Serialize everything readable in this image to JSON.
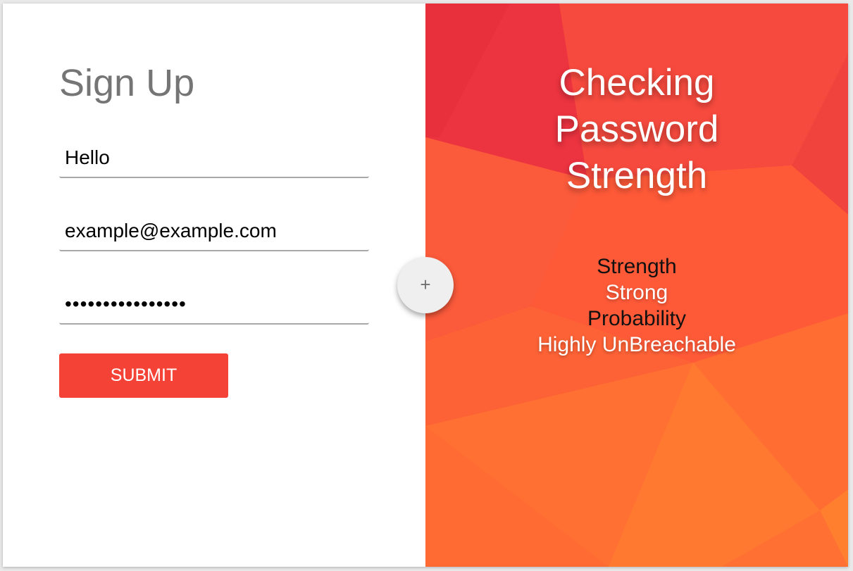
{
  "form": {
    "title": "Sign Up",
    "name_value": "Hello",
    "email_value": "example@example.com",
    "password_value": "••••••••••••••••",
    "submit_label": "SUBMIT"
  },
  "fab": {
    "label": "+",
    "icon": "plus-icon"
  },
  "panel": {
    "heading_lines": [
      "Checking",
      "Password",
      "Strength"
    ],
    "strength_label": "Strength",
    "strength_value": "Strong",
    "probability_label": "Probability",
    "probability_value": "Highly UnBreachable"
  },
  "colors": {
    "accent": "#f44336",
    "panel_red": "#ee3a3c",
    "panel_orange": "#ff7a30",
    "title_gray": "#757575"
  }
}
